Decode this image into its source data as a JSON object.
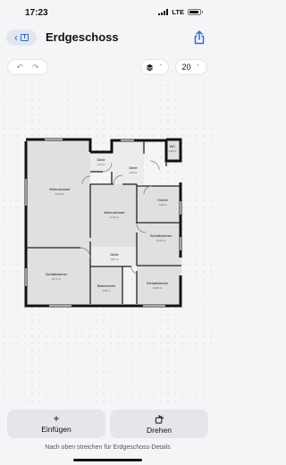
{
  "status_bar": {
    "time": "17:23",
    "network": "LTE"
  },
  "nav": {
    "title": "Erdgeschoss"
  },
  "toolbar": {
    "zoom_value": "20"
  },
  "rooms": [
    {
      "name": "Diele",
      "area": "4,76 m²"
    },
    {
      "name": "Diele",
      "area": "4,92 m²"
    },
    {
      "name": "WC",
      "area": "1,99 m²"
    },
    {
      "name": "Wohnzimmer",
      "area": "40,00 m²"
    },
    {
      "name": "Wohnzimmer",
      "area": "24,72 m²"
    },
    {
      "name": "Küche",
      "area": "7,68 m²"
    },
    {
      "name": "Schlafzimmer",
      "area": "14,22 m²"
    },
    {
      "name": "Diele",
      "area": "3,82 m²"
    },
    {
      "name": "Schlafzimmer",
      "area": "18,77 m²"
    },
    {
      "name": "Badezimmer",
      "area": "5,58 m²"
    },
    {
      "name": "Schlafzimmer",
      "area": "16,98 m²"
    }
  ],
  "actions": {
    "add_label": "Einfügen",
    "rotate_label": "Drehen"
  },
  "hint": "Nach oben streichen für Erdgeschoss-Details"
}
